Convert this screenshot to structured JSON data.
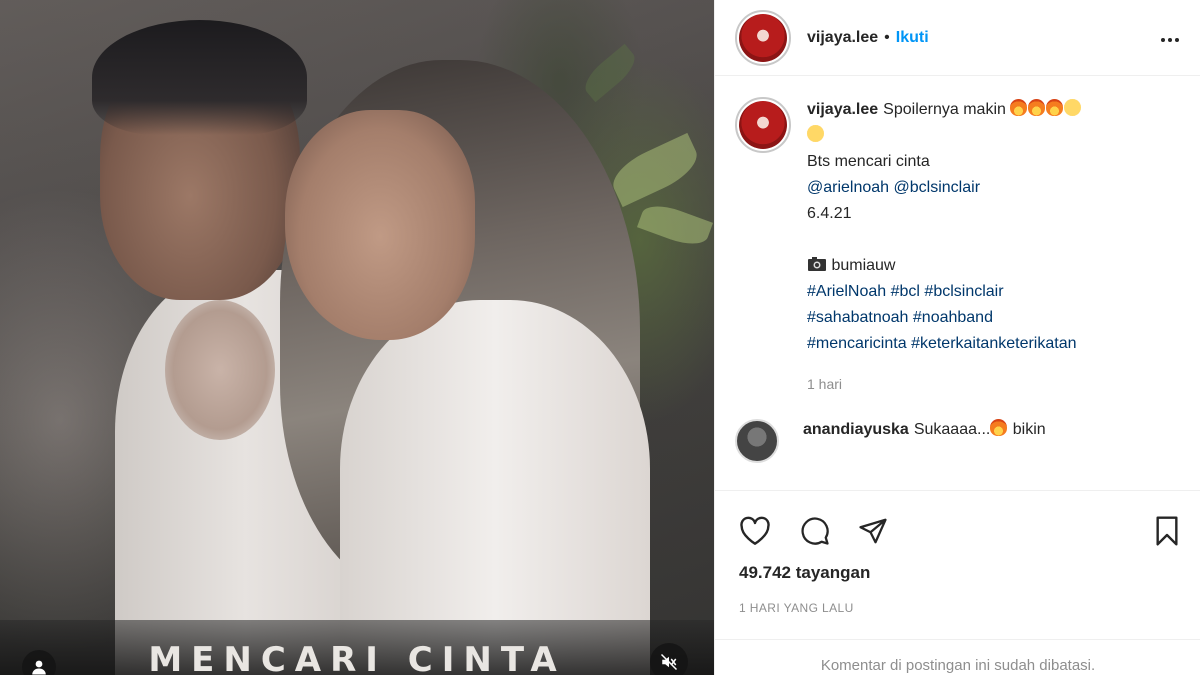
{
  "media": {
    "overlay_title": "MENCARI CINTA",
    "profile_icon": "user-icon",
    "mute_icon": "speaker-muted-icon"
  },
  "header": {
    "username": "vijaya.lee",
    "separator": "•",
    "follow_label": "Ikuti",
    "more_icon": "more-horizontal-icon"
  },
  "caption": {
    "username": "vijaya.lee",
    "text": "Spoilernya makin",
    "emojis": [
      "fire",
      "fire",
      "fire",
      "smiling-face-with-hearts",
      "grinning-face"
    ],
    "line2": "Bts mencari cinta",
    "mentions": [
      "@arielnoah",
      "@bclsinclair"
    ],
    "date": "6.4.21",
    "credit": "bumiauw",
    "credit_icon": "camera-icon",
    "hashtags_line1": [
      "#ArielNoah",
      "#bcl",
      "#bclsinclair"
    ],
    "hashtags_line2": [
      "#sahabatnoah",
      "#noahband"
    ],
    "hashtags_line3": [
      "#mencaricinta",
      "#keterkaitanketerikatan"
    ],
    "time": "1 hari"
  },
  "reply": {
    "username": "anandiayuska",
    "text": "Sukaaaa...",
    "text_after": "bikin"
  },
  "actions": {
    "like_icon": "heart-icon",
    "comment_icon": "comment-icon",
    "share_icon": "paper-plane-icon",
    "save_icon": "bookmark-icon"
  },
  "stats": {
    "views": "49.742 tayangan",
    "posted": "1 HARI YANG LALU"
  },
  "footer": {
    "comments_limited": "Komentar di postingan ini sudah dibatasi."
  },
  "colors": {
    "follow_blue": "#0095f6",
    "link_dark_blue": "#00376b",
    "muted_gray": "#8e8e8e"
  }
}
